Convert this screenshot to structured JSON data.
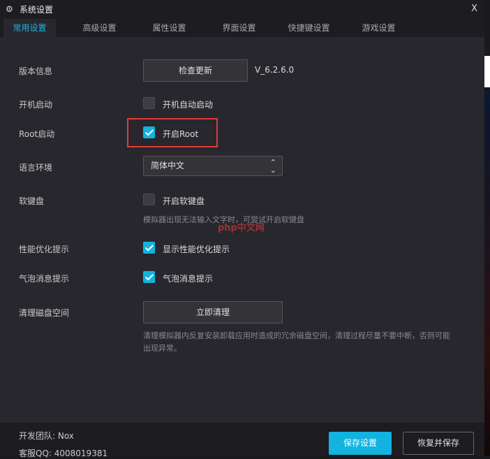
{
  "window": {
    "title": "系统设置",
    "close": "X"
  },
  "tabs": [
    "常用设置",
    "高级设置",
    "属性设置",
    "界面设置",
    "快捷键设置",
    "游戏设置"
  ],
  "settings": {
    "version": {
      "label": "版本信息",
      "button": "检查更新",
      "value": "V_6.2.6.0"
    },
    "autostart": {
      "label": "开机启动",
      "checkbox": "开机自动启动",
      "checked": false
    },
    "root": {
      "label": "Root启动",
      "checkbox": "开启Root",
      "checked": true
    },
    "language": {
      "label": "语言环境",
      "value": "简体中文"
    },
    "keyboard": {
      "label": "软键盘",
      "checkbox": "开启软键盘",
      "checked": false,
      "hint": "模拟器出现无法输入文字时，可尝试开启软键盘"
    },
    "perf": {
      "label": "性能优化提示",
      "checkbox": "显示性能优化提示",
      "checked": true
    },
    "bubble": {
      "label": "气泡消息提示",
      "checkbox": "气泡消息提示",
      "checked": true
    },
    "clean": {
      "label": "清理磁盘空间",
      "button": "立即清理",
      "hint": "清理模拟器内反复安装卸载应用时造成的冗余磁盘空间，清理过程尽量不要中断，否则可能出现异常。"
    }
  },
  "footer": {
    "team": "开发团队:  Nox",
    "qq": "客服QQ:   4008019381",
    "save": "保存设置",
    "restore": "恢复并保存"
  },
  "watermark": "php中文网",
  "colors": {
    "accent": "#12b3e0",
    "highlight": "#e03c3c"
  }
}
